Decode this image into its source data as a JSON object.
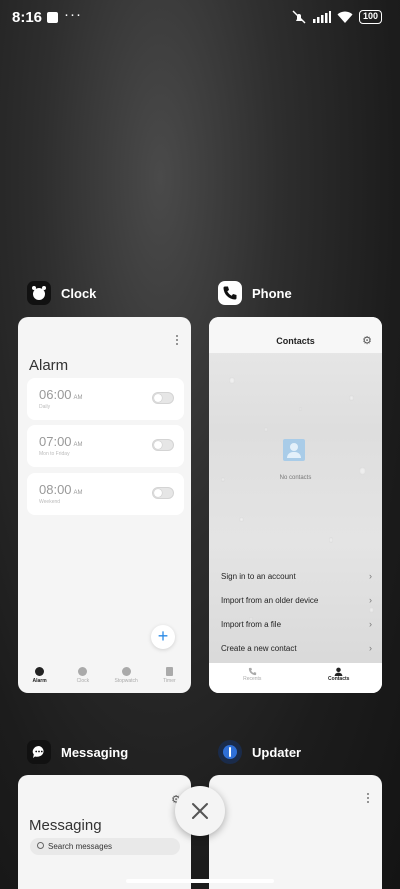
{
  "status_bar": {
    "time": "8:16",
    "more": "···",
    "battery": "100",
    "icons": [
      "silent-icon",
      "signal-icon",
      "wifi-icon",
      "battery-icon"
    ]
  },
  "apps": {
    "clock": {
      "name": "Clock",
      "title": "Alarm",
      "alarms": [
        {
          "time": "06:00",
          "ampm": "AM",
          "label": "Daily"
        },
        {
          "time": "07:00",
          "ampm": "AM",
          "label": "Mon to Friday"
        },
        {
          "time": "08:00",
          "ampm": "AM",
          "label": "Weekend"
        }
      ],
      "fab": "+",
      "nav": [
        "Alarm",
        "Clock",
        "Stopwatch",
        "Timer"
      ]
    },
    "phone": {
      "name": "Phone",
      "title": "Contacts",
      "empty_text": "No contacts",
      "actions": [
        "Sign in to an account",
        "Import from an older device",
        "Import from a file",
        "Create a new contact"
      ],
      "nav": [
        "Recents",
        "Contacts"
      ]
    },
    "messaging": {
      "name": "Messaging",
      "title": "Messaging",
      "search_placeholder": "Search messages"
    },
    "updater": {
      "name": "Updater"
    }
  },
  "colors": {
    "accent": "#2b8ae6",
    "card": "#f5f5f5"
  }
}
